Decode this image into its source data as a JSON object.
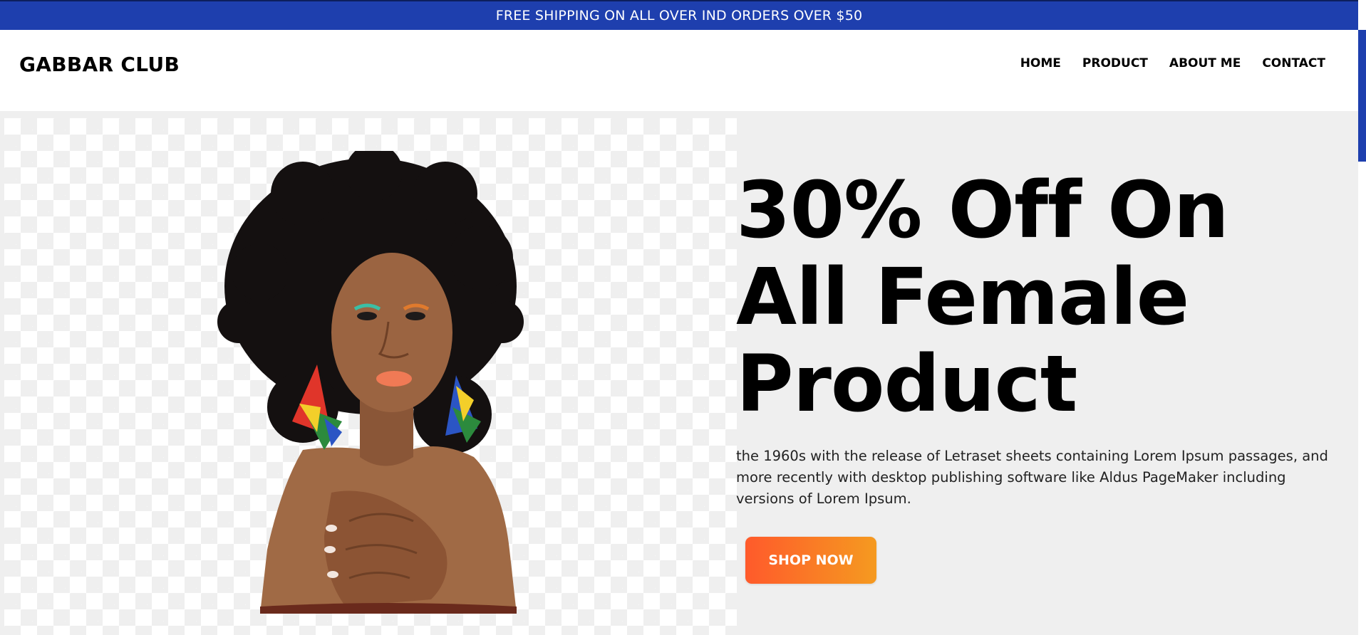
{
  "announcement": {
    "text": "FREE SHIPPING ON ALL OVER IND ORDERS OVER $50"
  },
  "header": {
    "brand": "GABBAR CLUB",
    "nav": [
      {
        "label": "HOME"
      },
      {
        "label": "PRODUCT"
      },
      {
        "label": "ABOUT ME"
      },
      {
        "label": "CONTACT"
      }
    ]
  },
  "hero": {
    "headline_lines": [
      "30% Off On",
      "All Female",
      "Product"
    ],
    "description": "the 1960s with the release of Letraset sheets containing Lorem Ipsum passages, and more recently with desktop publishing software like Aldus PageMaker including versions of Lorem Ipsum.",
    "cta_label": "SHOP NOW"
  },
  "colors": {
    "announcement_bg": "#1e3fae",
    "hero_bg": "#efefef",
    "cta_gradient_start": "#ff5a2b",
    "cta_gradient_end": "#f59a20"
  }
}
